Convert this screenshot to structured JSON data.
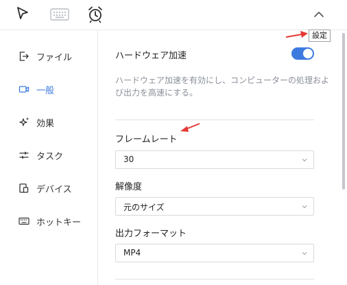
{
  "tooltip": {
    "text": "設定"
  },
  "sidebar": {
    "items": [
      {
        "label": "ファイル"
      },
      {
        "label": "一般"
      },
      {
        "label": "効果"
      },
      {
        "label": "タスク"
      },
      {
        "label": "デバイス"
      },
      {
        "label": "ホットキー"
      }
    ],
    "active_index": 1
  },
  "settings": {
    "hardware_acceleration": {
      "label": "ハードウェア加速",
      "enabled": true,
      "description": "ハードウェア加速を有効にし、コンピューターの処理および出力を高速にする。"
    },
    "frame_rate": {
      "label": "フレームレート",
      "value": "30"
    },
    "resolution": {
      "label": "解像度",
      "value": "元のサイズ"
    },
    "output_format": {
      "label": "出力フォーマット",
      "value": "MP4"
    }
  },
  "colors": {
    "accent": "#3d7ae0",
    "annotation_arrow": "#e53935",
    "description_text": "#8a8f99"
  },
  "icons": {
    "toolbar": [
      "pointer-icon",
      "keyboard-icon",
      "alarm-clock-icon",
      "chevron-up-icon"
    ],
    "sidebar": [
      "file-export-icon",
      "camera-icon",
      "sparkle-icon",
      "sliders-icon",
      "device-icon",
      "keyboard-icon"
    ]
  }
}
